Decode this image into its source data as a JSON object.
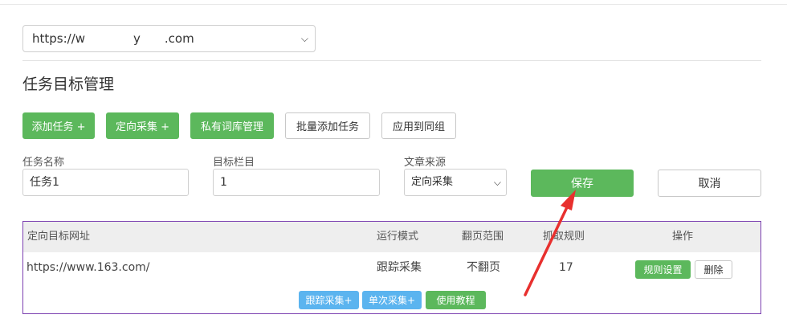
{
  "site_select": {
    "value": "https://w    y  .com"
  },
  "page_title": "任务目标管理",
  "toolbar": {
    "add_task": "添加任务 +",
    "targeted_collect": "定向采集 +",
    "private_lexicon": "私有词库管理",
    "batch_add": "批量添加任务",
    "apply_group": "应用到同组"
  },
  "form": {
    "task_name_label": "任务名称",
    "task_name_value": "任务1",
    "target_column_label": "目标栏目",
    "target_column_value": "1",
    "source_label": "文章来源",
    "source_value": "定向采集",
    "save": "保存",
    "cancel": "取消"
  },
  "table": {
    "headers": [
      "定向目标网址",
      "运行模式",
      "翻页范围",
      "抓取规则",
      "操作"
    ],
    "rows": [
      {
        "url": "https://www.163.com/",
        "mode": "跟踪采集",
        "paging": "不翻页",
        "rule": "17",
        "rule_settings": "规则设置",
        "delete": "删除"
      }
    ],
    "footer": {
      "track": "跟踪采集+",
      "single": "单次采集+",
      "tutorial": "使用教程"
    }
  },
  "colors": {
    "green": "#5cb85c",
    "blue": "#5bb4ef",
    "annotation_red": "#e8302e",
    "table_border": "#7b3fb0"
  }
}
